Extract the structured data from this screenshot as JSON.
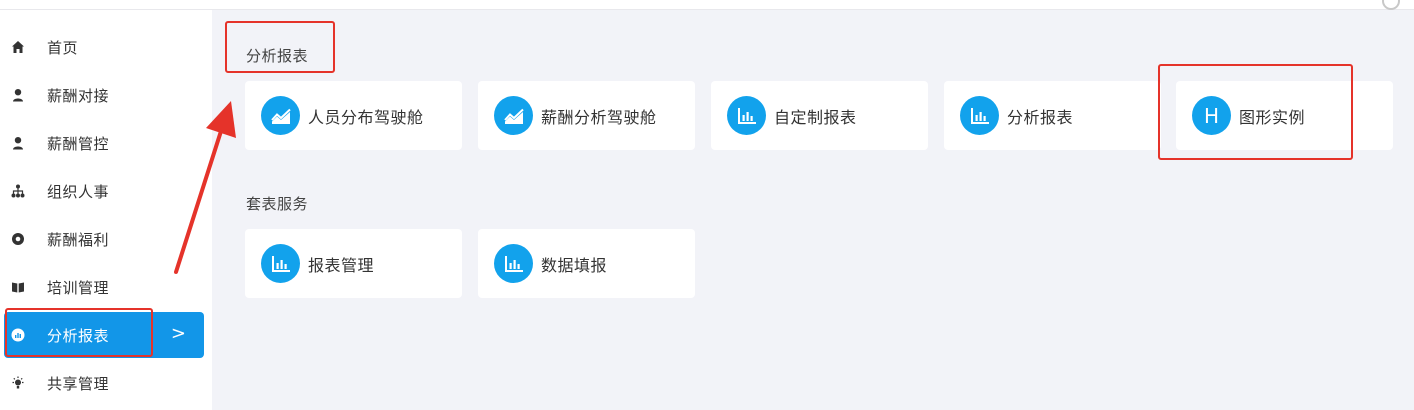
{
  "sidebar": {
    "items": [
      {
        "label": "首页",
        "icon": "home-icon"
      },
      {
        "label": "薪酬对接",
        "icon": "user-icon"
      },
      {
        "label": "薪酬管控",
        "icon": "user-icon"
      },
      {
        "label": "组织人事",
        "icon": "org-tree-icon"
      },
      {
        "label": "薪酬福利",
        "icon": "circle-dot-icon"
      },
      {
        "label": "培训管理",
        "icon": "book-icon"
      },
      {
        "label": "分析报表",
        "icon": "chart-circle-icon",
        "active": true,
        "chevron": ">"
      },
      {
        "label": "共享管理",
        "icon": "lightbulb-icon"
      }
    ]
  },
  "sections": {
    "analysis": {
      "title": "分析报表",
      "cards": [
        {
          "label": "人员分布驾驶舱",
          "icon": "dashboard-chart-icon"
        },
        {
          "label": "薪酬分析驾驶舱",
          "icon": "dashboard-chart-icon"
        },
        {
          "label": "自定制报表",
          "icon": "bar-chart-icon"
        },
        {
          "label": "分析报表",
          "icon": "bar-chart-icon"
        },
        {
          "label": "图形实例",
          "icon": "letter-h-icon",
          "icon_text": "H"
        }
      ]
    },
    "service": {
      "title": "套表服务",
      "cards": [
        {
          "label": "报表管理",
          "icon": "bar-chart-icon"
        },
        {
          "label": "数据填报",
          "icon": "bar-chart-icon"
        }
      ]
    }
  },
  "colors": {
    "accent": "#1296e8",
    "card_icon": "#12a2ec",
    "annotation": "#e5332a",
    "main_bg": "#f2f3f8"
  }
}
